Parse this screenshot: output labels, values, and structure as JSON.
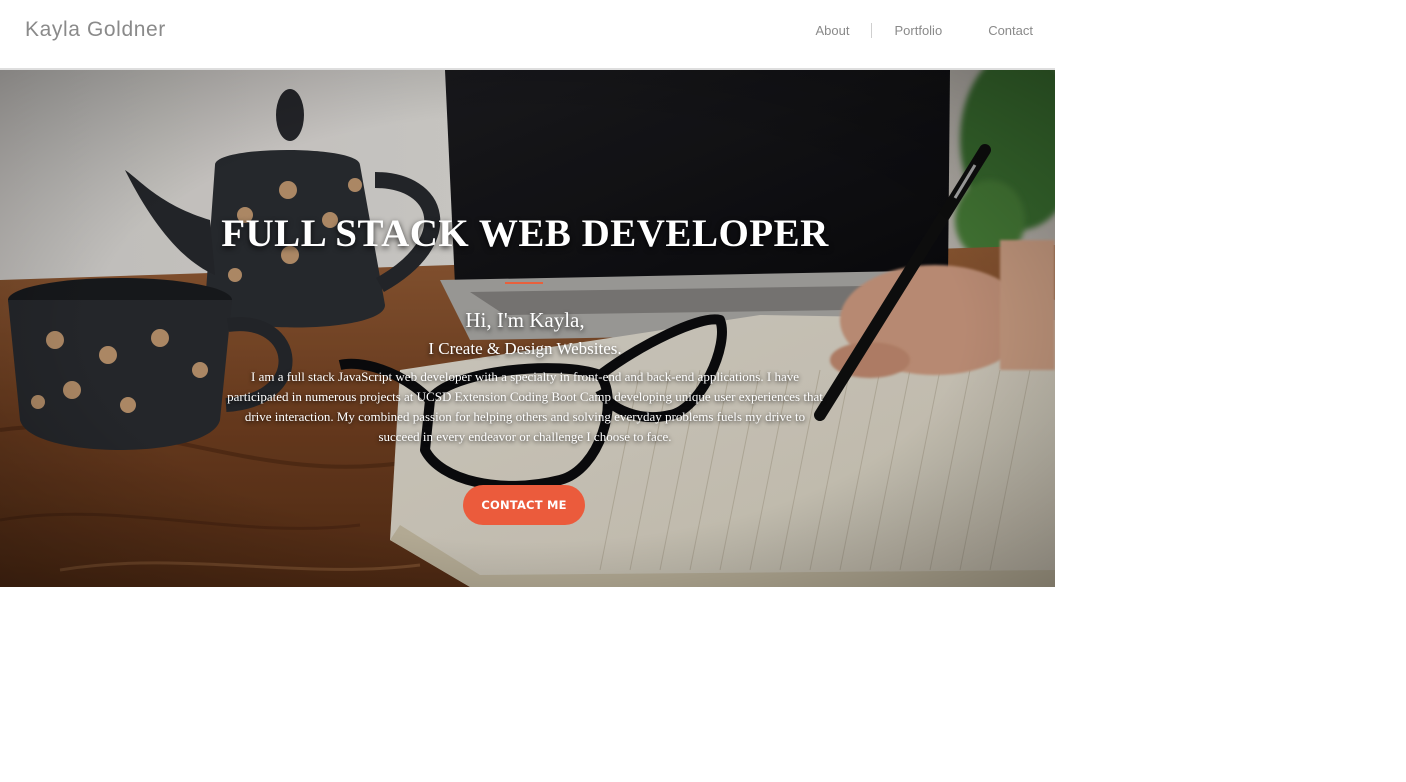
{
  "header": {
    "brand": "Kayla Goldner",
    "nav": {
      "about": "About",
      "portfolio": "Portfolio",
      "contact": "Contact"
    }
  },
  "hero": {
    "title": "FULL STACK WEB DEVELOPER",
    "greeting": "Hi, I'm Kayla,",
    "tagline": "I Create & Design Websites.",
    "bio": "I am a full stack JavaScript web developer with a specialty in front-end and back-end applications. I have participated in numerous projects at UCSD Extension Coding Boot Camp developing unique user experiences that drive interaction. My combined passion for helping others and solving everyday problems fuels my drive to succeed in every endeavor or challenge I choose to face.",
    "cta_label": "CONTACT ME"
  },
  "colors": {
    "accent": "#eb5b3c",
    "nav_text": "#8a8a8a",
    "header_border": "#dedede"
  },
  "icons": {
    "hero_image": "desk-with-teapot-cups-glasses-laptop-notebook-photo"
  }
}
